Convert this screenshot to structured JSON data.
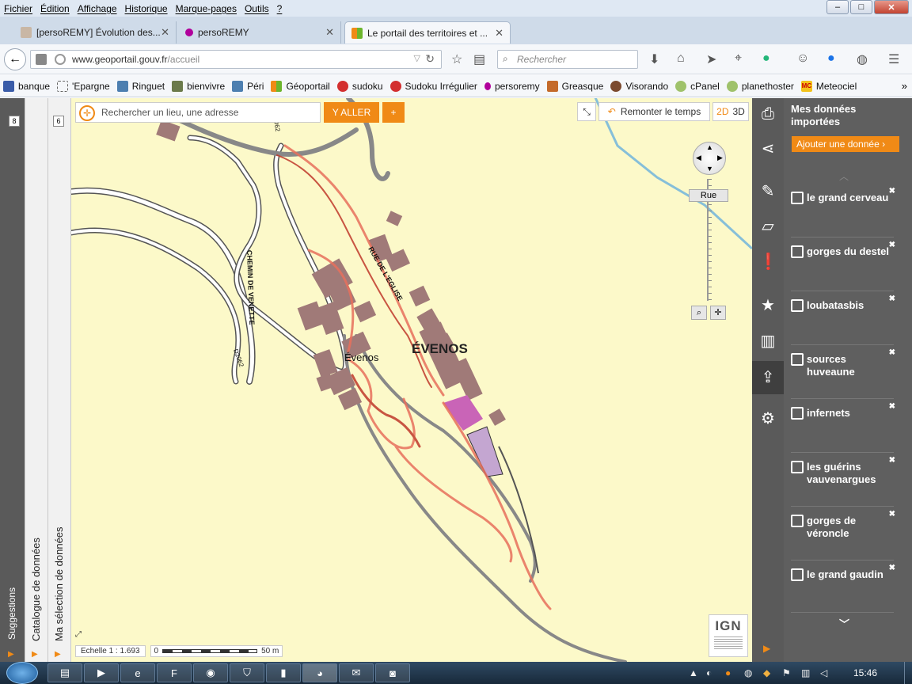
{
  "menu": [
    "Fichier",
    "Édition",
    "Affichage",
    "Historique",
    "Marque-pages",
    "Outils",
    "?"
  ],
  "window_buttons": {
    "minimize": "–",
    "maximize": "□",
    "close": "✕"
  },
  "tabs": [
    {
      "label": "[persoREMY] Évolution des...",
      "close": "✕"
    },
    {
      "label": "persoREMY",
      "close": "✕"
    },
    {
      "label": "Le portail des territoires et ...",
      "close": "✕",
      "active": true
    }
  ],
  "new_tab": "+",
  "url": {
    "domain": "www.geoportail.gouv.fr",
    "path": "/accueil"
  },
  "search_placeholder": "Rechercher",
  "bookmarks": [
    "banque",
    "'Epargne",
    "Ringuet",
    "bienvivre",
    "Péri",
    "Géoportail",
    "sudoku",
    "Sudoku Irrégulier",
    "persoremy",
    "Greasque",
    "Visorando",
    "cPanel",
    "planethoster",
    "Meteociel"
  ],
  "bookmarks_overflow": "»",
  "left_panels": {
    "suggestions": "Suggestions",
    "catalogue": "Catalogue de données",
    "catalogue_badge": "8",
    "selection": "Ma sélection de données",
    "selection_badge": "6"
  },
  "map": {
    "search_placeholder": "Rechercher un lieu, une adresse",
    "go_button": "Y ALLER",
    "plus_button": "+",
    "remonter": "Remonter le temps",
    "view_2d": "2D",
    "view_3d": "3D",
    "zoom_label": "Rue",
    "labels": {
      "village_big": "ÉVENOS",
      "village_small": "Évenos",
      "street_eglise": "RUE DE L'EGLISE",
      "chemin": "CHEMIN DE VENETTE",
      "road_1": "D62",
      "road_2": "D2062"
    },
    "scale_text": "Echelle 1 :",
    "scale_value": "1.693",
    "scale_zero": "0",
    "scale_end": "50 m",
    "ign_logo": "IGN"
  },
  "colors": {
    "accent": "#f08a16",
    "map_bg": "#fcf9c9",
    "panel": "#5f5f5f",
    "track": "#e8705c",
    "building": "#a07a78"
  },
  "data_panel": {
    "title": "Mes données importées",
    "add_button": "Ajouter une donnée ›",
    "items": [
      "le grand cerveau",
      "gorges du destel",
      "loubatasbis",
      "sources huveaune",
      "infernets",
      "les guérins vauvenargues",
      "gorges de véroncle",
      "le grand gaudin"
    ],
    "remove_glyph": "✖"
  },
  "taskbar": {
    "clock": "15:46"
  }
}
